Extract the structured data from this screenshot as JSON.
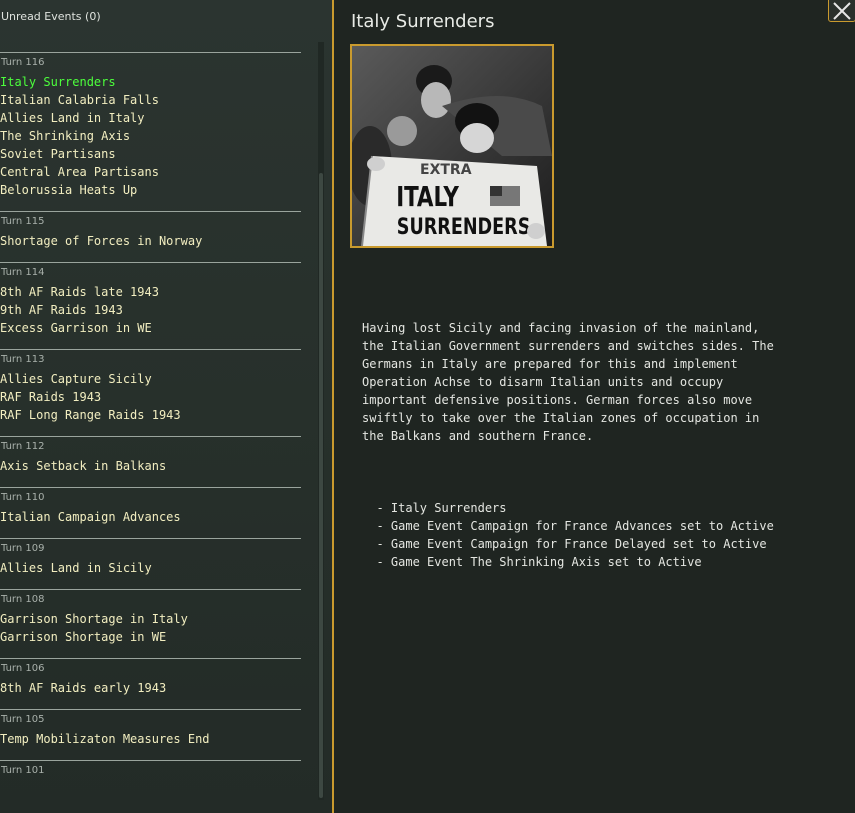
{
  "sidebar": {
    "unread_label": "Unread Events (0)",
    "turns": [
      {
        "header": "Turn 116",
        "events": [
          "Italy Surrenders",
          "Italian Calabria Falls",
          "Allies Land in Italy",
          "The Shrinking Axis",
          "Soviet Partisans",
          "Central Area Partisans",
          "Belorussia Heats Up"
        ]
      },
      {
        "header": "Turn 115",
        "events": [
          "Shortage of Forces in Norway"
        ]
      },
      {
        "header": "Turn 114",
        "events": [
          "8th AF Raids late 1943",
          "9th AF Raids 1943",
          "Excess Garrison in WE"
        ]
      },
      {
        "header": "Turn 113",
        "events": [
          "Allies Capture Sicily",
          "RAF Raids 1943",
          "RAF Long Range Raids 1943"
        ]
      },
      {
        "header": "Turn 112",
        "events": [
          "Axis Setback in Balkans"
        ]
      },
      {
        "header": "Turn 110",
        "events": [
          "Italian Campaign Advances"
        ]
      },
      {
        "header": "Turn 109",
        "events": [
          "Allies Land in Sicily"
        ]
      },
      {
        "header": "Turn 108",
        "events": [
          "Garrison Shortage in Italy",
          "Garrison Shortage in WE"
        ]
      },
      {
        "header": "Turn 106",
        "events": [
          "8th AF Raids early 1943"
        ]
      },
      {
        "header": "Turn 105",
        "events": [
          "Temp Mobilizaton Measures End"
        ]
      },
      {
        "header": "Turn 101",
        "events": []
      }
    ],
    "selected_event": "Italy Surrenders"
  },
  "detail": {
    "title": "Italy Surrenders",
    "image": {
      "icon": "newspaper-photo",
      "headline_top": "EXTRA",
      "headline_line1": "ITALY",
      "headline_line2": "SURRENDERS"
    },
    "description_lines": [
      "Having lost Sicily and facing invasion of the mainland,",
      "the Italian Government surrenders and switches sides. The",
      "Germans in Italy are prepared for this and implement",
      "Operation Achse to disarm Italian units and occupy",
      "important defensive positions. German forces also move",
      "swiftly to take over the Italian zones of occupation in",
      "the Balkans and southern France."
    ],
    "effects": [
      "  - Italy Surrenders",
      "  - Game Event Campaign for France Advances set to Active",
      "  - Game Event Campaign for France Delayed set to Active",
      "  - Game Event The Shrinking Axis set to Active"
    ]
  },
  "colors": {
    "accent": "#c99a2e",
    "selected_event": "#4cff3c",
    "event_text": "#f2eec0"
  }
}
